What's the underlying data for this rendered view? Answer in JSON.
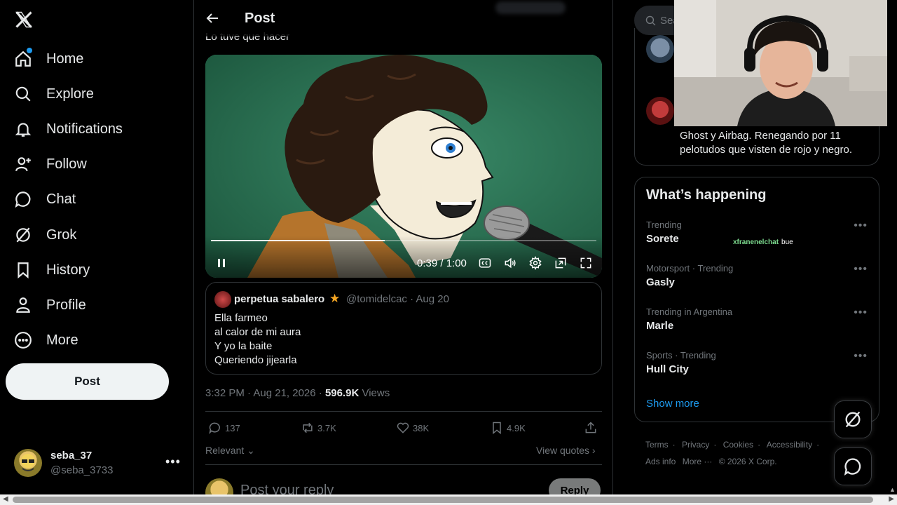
{
  "nav": {
    "items": [
      {
        "label": "Home",
        "icon": "home-icon"
      },
      {
        "label": "Explore",
        "icon": "search-icon"
      },
      {
        "label": "Notifications",
        "icon": "bell-icon"
      },
      {
        "label": "Follow",
        "icon": "add-person-icon"
      },
      {
        "label": "Chat",
        "icon": "chat-bubble-icon"
      },
      {
        "label": "Grok",
        "icon": "grok-icon"
      },
      {
        "label": "History",
        "icon": "bookmark-icon"
      },
      {
        "label": "Profile",
        "icon": "person-icon"
      },
      {
        "label": "More",
        "icon": "more-circle-icon"
      }
    ],
    "post_button": "Post"
  },
  "account": {
    "name": "seba_37",
    "handle": "@seba_3733",
    "menu": "•••"
  },
  "header": {
    "title": "Post"
  },
  "tweet": {
    "text": "Lo tuve que hacer",
    "video": {
      "time": "0:39 / 1:00",
      "progress": 0.45
    },
    "timestamp": "3:32 PM · Aug 21, 2026 · ",
    "views_count": "596.9K",
    "views_label": " Views"
  },
  "quote": {
    "name": "perpetua sabalero",
    "star": "★",
    "handle_date": "@tomidelcac · Aug 20",
    "lines": [
      "Ella farmeo",
      "al calor de mi aura",
      "Y yo la baite",
      "Queriendo jijearla"
    ]
  },
  "actions": {
    "replies": "137",
    "reposts": "3.7K",
    "likes": "38K",
    "bookmarks": "4.9K"
  },
  "sort": {
    "label": "Relevant",
    "view_quotes": "View quotes"
  },
  "reply": {
    "placeholder": "Post your reply",
    "button": "Reply"
  },
  "search": {
    "placeholder": "Sea"
  },
  "sidebar_card": {
    "text": "Ghost y Airbag. Renegando por 11 pelotudos que visten de rojo y negro."
  },
  "happening": {
    "title": "What’s happening",
    "trends": [
      {
        "context": "Trending",
        "title": "Sorete"
      },
      {
        "context": "Motorsport · Trending",
        "title": "Gasly"
      },
      {
        "context": "Trending in Argentina",
        "title": "Marle"
      },
      {
        "context": "Sports · Trending",
        "title": "Hull City"
      }
    ],
    "show_more": "Show more"
  },
  "stream_chat": {
    "user": "xfranenelchat",
    "message": "bue"
  },
  "footer": {
    "links": [
      "Terms",
      "Privacy",
      "Cookies",
      "Accessibility",
      "Ads info",
      "More ···",
      "© 2026 X Corp."
    ]
  },
  "colors": {
    "accent": "#1d9bf0",
    "background": "#000000",
    "text": "#e7e9ea",
    "muted": "#71767b"
  }
}
